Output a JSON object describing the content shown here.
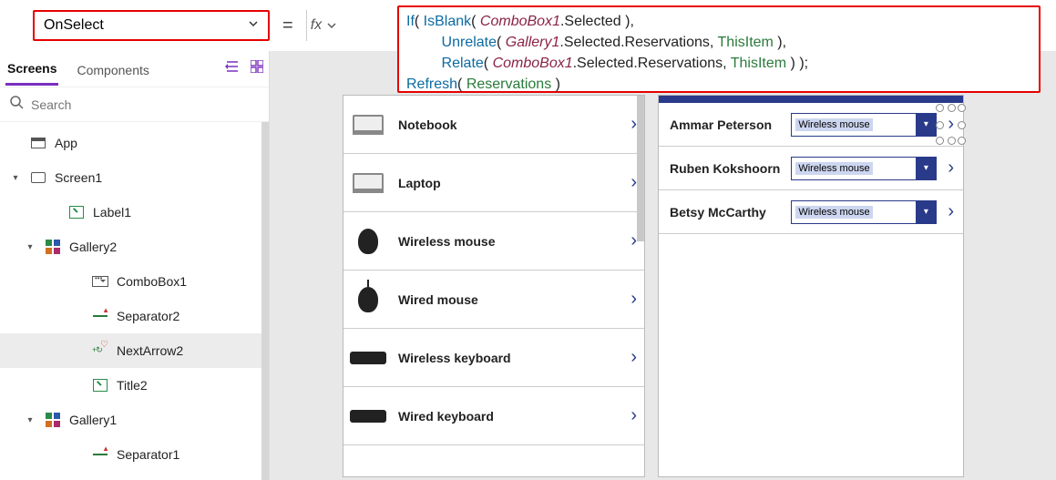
{
  "topbar": {
    "property": "OnSelect",
    "equals": "=",
    "fx_label": "fx"
  },
  "formula": {
    "tokens": [
      {
        "t": "fn",
        "v": "If"
      },
      {
        "t": "p",
        "v": "( "
      },
      {
        "t": "fn",
        "v": "IsBlank"
      },
      {
        "t": "p",
        "v": "( "
      },
      {
        "t": "id",
        "v": "ComboBox1"
      },
      {
        "t": "p",
        "v": ".Selected ),"
      },
      {
        "t": "nl",
        "v": "\n    "
      },
      {
        "t": "fn",
        "v": "Unrelate"
      },
      {
        "t": "p",
        "v": "( "
      },
      {
        "t": "id",
        "v": "Gallery1"
      },
      {
        "t": "p",
        "v": ".Selected.Reservations, "
      },
      {
        "t": "kw",
        "v": "ThisItem"
      },
      {
        "t": "p",
        "v": " ),"
      },
      {
        "t": "nl",
        "v": "\n    "
      },
      {
        "t": "fn",
        "v": "Relate"
      },
      {
        "t": "p",
        "v": "( "
      },
      {
        "t": "id",
        "v": "ComboBox1"
      },
      {
        "t": "p",
        "v": ".Selected.Reservations, "
      },
      {
        "t": "kw",
        "v": "ThisItem"
      },
      {
        "t": "p",
        "v": " ) );"
      },
      {
        "t": "nl",
        "v": "\n"
      },
      {
        "t": "fn",
        "v": "Refresh"
      },
      {
        "t": "p",
        "v": "( "
      },
      {
        "t": "kw",
        "v": "Reservations"
      },
      {
        "t": "p",
        "v": " )"
      }
    ]
  },
  "left_panel": {
    "tabs": {
      "screens": "Screens",
      "components": "Components"
    },
    "search_placeholder": "Search",
    "tree": [
      {
        "name": "app",
        "label": "App",
        "indent": 0,
        "icon": "app",
        "caret": ""
      },
      {
        "name": "screen1",
        "label": "Screen1",
        "indent": 0,
        "icon": "screen",
        "caret": "▾"
      },
      {
        "name": "label1",
        "label": "Label1",
        "indent": 2,
        "icon": "label",
        "caret": ""
      },
      {
        "name": "gallery2",
        "label": "Gallery2",
        "indent": 1,
        "icon": "gallery",
        "caret": "▾"
      },
      {
        "name": "combobox1",
        "label": "ComboBox1",
        "indent": 3,
        "icon": "combo",
        "caret": ""
      },
      {
        "name": "separator2",
        "label": "Separator2",
        "indent": 3,
        "icon": "sep",
        "caret": ""
      },
      {
        "name": "nextarrow2",
        "label": "NextArrow2",
        "indent": 3,
        "icon": "next",
        "caret": "",
        "selected": true
      },
      {
        "name": "title2",
        "label": "Title2",
        "indent": 3,
        "icon": "label",
        "caret": ""
      },
      {
        "name": "gallery1",
        "label": "Gallery1",
        "indent": 1,
        "icon": "gallery",
        "caret": "▾"
      },
      {
        "name": "separator1",
        "label": "Separator1",
        "indent": 3,
        "icon": "sep",
        "caret": ""
      }
    ]
  },
  "canvas": {
    "products": [
      {
        "label": "Notebook",
        "thumb": "laptop"
      },
      {
        "label": "Laptop",
        "thumb": "laptop"
      },
      {
        "label": "Wireless mouse",
        "thumb": "mouse"
      },
      {
        "label": "Wired mouse",
        "thumb": "mouse-wired"
      },
      {
        "label": "Wireless keyboard",
        "thumb": "kbd"
      },
      {
        "label": "Wired keyboard",
        "thumb": "kbd"
      }
    ],
    "reservations": [
      {
        "name": "Ammar Peterson",
        "combo": "Wireless mouse",
        "selected": true
      },
      {
        "name": "Ruben Kokshoorn",
        "combo": "Wireless mouse",
        "selected": false
      },
      {
        "name": "Betsy McCarthy",
        "combo": "Wireless mouse",
        "selected": false
      }
    ]
  }
}
